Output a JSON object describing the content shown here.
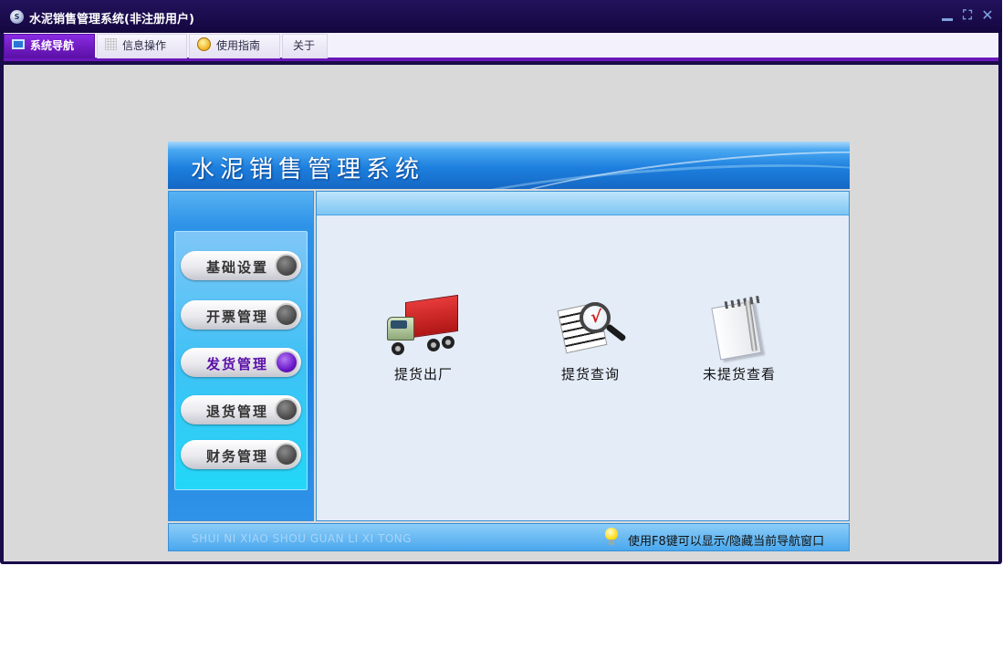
{
  "window": {
    "title": "水泥销售管理系统(非注册用户)",
    "app_icon_text": "S",
    "controls": {
      "minimize": "",
      "restore": "⛶",
      "close": "✕"
    }
  },
  "tabs": [
    {
      "label": "系统导航",
      "icon": "monitor-icon",
      "active": true
    },
    {
      "label": "信息操作",
      "icon": "grid-icon",
      "active": false
    },
    {
      "label": "使用指南",
      "icon": "help-icon",
      "active": false
    },
    {
      "label": "关于",
      "icon": "",
      "active": false
    }
  ],
  "banner": {
    "title": "水泥销售管理系统"
  },
  "menu": [
    {
      "label": "基础设置",
      "selected": false
    },
    {
      "label": "开票管理",
      "selected": false
    },
    {
      "label": "发货管理",
      "selected": true
    },
    {
      "label": "退货管理",
      "selected": false
    },
    {
      "label": "财务管理",
      "selected": false
    }
  ],
  "functions": [
    {
      "label": "提货出厂",
      "icon": "truck-icon"
    },
    {
      "label": "提货查询",
      "icon": "magnifier-icon"
    },
    {
      "label": "未提货查看",
      "icon": "notepad-icon"
    }
  ],
  "status": {
    "english": "SHUI NI XIAO SHOU GUAN LI XI TONG",
    "hint": "使用F8键可以显示/隐藏当前导航窗口"
  },
  "colors": {
    "accent": "#6a17b8",
    "titlebar": "#1a0b4a",
    "banner": "#1d7fde",
    "selected_menu": "#5a0fa6"
  }
}
